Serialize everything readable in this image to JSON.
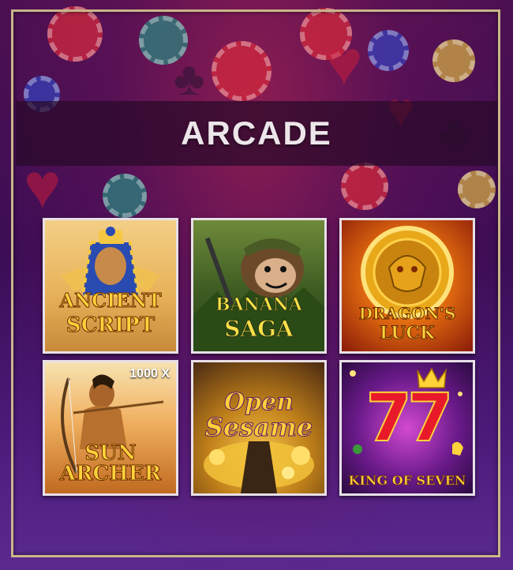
{
  "section": {
    "title": "ARCADE"
  },
  "games": [
    {
      "name": "ANCIENT SCRIPT",
      "line1": "ANCIENT",
      "line2": "SCRIPT"
    },
    {
      "name": "BANANA SAGA",
      "line1": "BANANA",
      "line2": "SAGA"
    },
    {
      "name": "DRAGON'S LUCK",
      "line1": "DRAGON'S",
      "line2": "LUCK"
    },
    {
      "name": "SUN ARCHER",
      "line1": "SUN",
      "line2": "ARCHER",
      "badge": "1000 X"
    },
    {
      "name": "Open Sesame",
      "line1": "Open",
      "line2": "Sesame"
    },
    {
      "name": "KING OF SEVEN",
      "line1": "77",
      "line2": "KING OF SEVEN"
    }
  ],
  "colors": {
    "banner_bg": "#280a28",
    "banner_text": "#ece6ea",
    "frame_border": "#c9b58a",
    "background_purple": "#3a0d55"
  },
  "icons": [
    "poker-chip-icon",
    "heart-suit-icon",
    "club-suit-icon"
  ]
}
